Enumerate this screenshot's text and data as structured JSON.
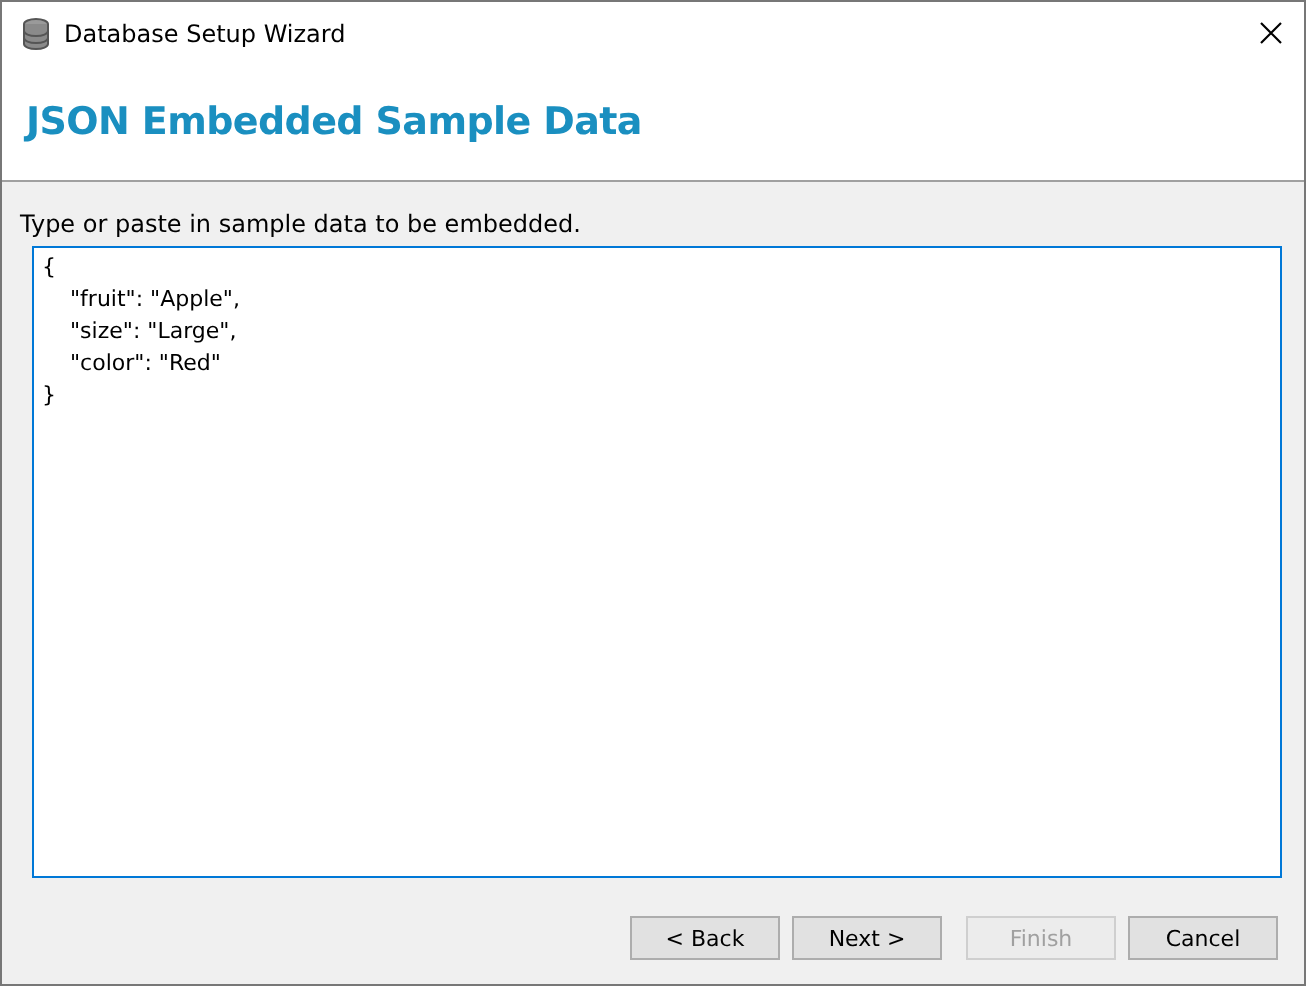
{
  "window": {
    "title": "Database Setup Wizard"
  },
  "header": {
    "title": "JSON Embedded Sample Data"
  },
  "prompt": "Type or paste in sample data to be embedded.",
  "editor": {
    "value": "{\n    \"fruit\": \"Apple\",\n    \"size\": \"Large\",\n    \"color\": \"Red\"\n}"
  },
  "buttons": [
    {
      "label": "< Back",
      "disabled": false
    },
    {
      "label": "Next >",
      "disabled": false
    },
    {
      "label": "Finish",
      "disabled": true
    },
    {
      "label": "Cancel",
      "disabled": false
    }
  ]
}
